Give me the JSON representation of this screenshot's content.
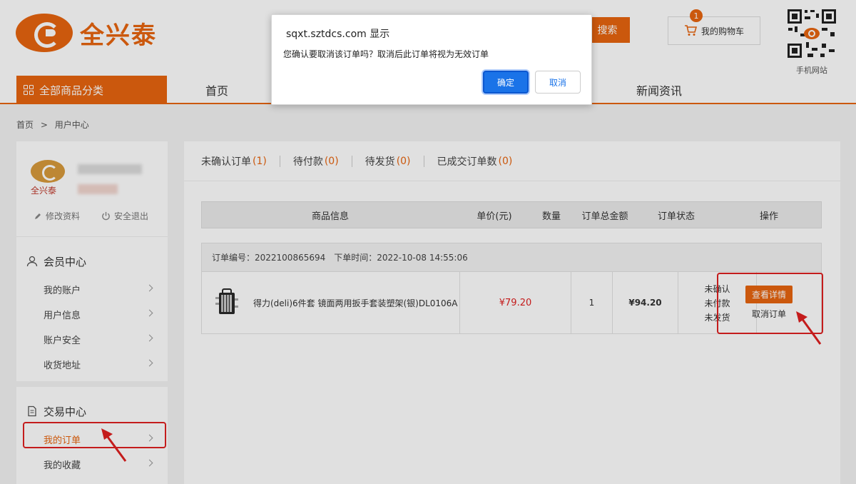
{
  "header": {
    "logo_text": "全兴泰",
    "search_label": "搜索",
    "cart_label": "我的购物车",
    "cart_count": "1",
    "qr_label": "手机网站"
  },
  "nav": {
    "all_categories": "全部商品分类",
    "items": [
      "首页",
      "新闻资讯"
    ]
  },
  "breadcrumb": {
    "home": "首页",
    "sep": ">",
    "current": "用户中心"
  },
  "sidebar": {
    "avatar_text": "全兴泰",
    "edit_profile": "修改资料",
    "logout": "安全退出",
    "member_center": {
      "title": "会员中心",
      "items": [
        "我的账户",
        "用户信息",
        "账户安全",
        "收货地址"
      ]
    },
    "trade_center": {
      "title": "交易中心",
      "items": [
        "我的订单",
        "我的收藏"
      ]
    }
  },
  "tabs": [
    {
      "label": "未确认订单",
      "count": "(1)"
    },
    {
      "label": "待付款",
      "count": "(0)"
    },
    {
      "label": "待发货",
      "count": "(0)"
    },
    {
      "label": "已成交订单数",
      "count": "(0)"
    }
  ],
  "table": {
    "headers": [
      "商品信息",
      "单价(元)",
      "数量",
      "订单总金额",
      "订单状态",
      "操作"
    ]
  },
  "order": {
    "number_label": "订单编号：2022100865694",
    "time_label": "下单时间：2022-10-08 14:55:06",
    "product_name": "得力(deli)6件套 镜面两用扳手套装塑架(银)DL0106A",
    "unit_price": "¥79.20",
    "quantity": "1",
    "total": "¥94.20",
    "status": [
      "未确认",
      "未付款",
      "未发货"
    ],
    "view_detail": "查看详情",
    "cancel_order": "取消订单"
  },
  "dialog": {
    "title": "sqxt.sztdcs.com 显示",
    "message": "您确认要取消该订单吗？取消后此订单将视为无效订单",
    "ok": "确定",
    "cancel": "取消"
  },
  "colors": {
    "accent": "#e8650f",
    "price_red": "#e02020",
    "dialog_primary": "#1a73e8"
  }
}
